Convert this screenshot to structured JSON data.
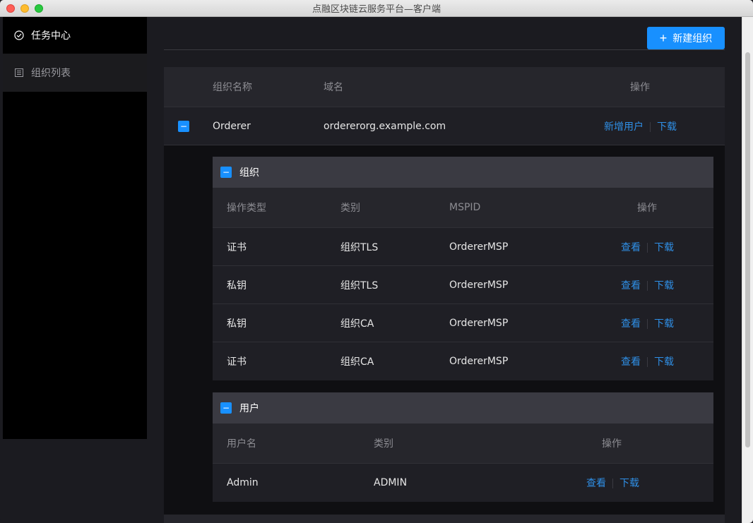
{
  "window": {
    "title": "点融区块链云服务平台—客户端"
  },
  "sidebar": {
    "items": [
      {
        "label": "任务中心",
        "icon": "check-circle-icon",
        "active": true
      },
      {
        "label": "组织列表",
        "icon": "list-icon",
        "active": false
      }
    ]
  },
  "toolbar": {
    "new_org_label": "新建组织"
  },
  "org_table": {
    "columns": [
      "组织名称",
      "域名",
      "操作"
    ],
    "rows": [
      {
        "name": "Orderer",
        "domain": "ordererorg.example.com",
        "actions": [
          "新增用户",
          "下载"
        ]
      }
    ]
  },
  "org_section": {
    "title": "组织",
    "columns": [
      "操作类型",
      "类别",
      "MSPID",
      "操作"
    ],
    "rows": [
      {
        "type": "证书",
        "category": "组织TLS",
        "mspid": "OrdererMSP",
        "actions": [
          "查看",
          "下载"
        ]
      },
      {
        "type": "私钥",
        "category": "组织TLS",
        "mspid": "OrdererMSP",
        "actions": [
          "查看",
          "下载"
        ]
      },
      {
        "type": "私钥",
        "category": "组织CA",
        "mspid": "OrdererMSP",
        "actions": [
          "查看",
          "下载"
        ]
      },
      {
        "type": "证书",
        "category": "组织CA",
        "mspid": "OrdererMSP",
        "actions": [
          "查看",
          "下载"
        ]
      }
    ]
  },
  "user_section": {
    "title": "用户",
    "columns": [
      "用户名",
      "类别",
      "操作"
    ],
    "rows": [
      {
        "username": "Admin",
        "category": "ADMIN",
        "actions": [
          "查看",
          "下载"
        ]
      }
    ]
  },
  "colors": {
    "accent": "#1890ff",
    "link": "#2f8fe6"
  }
}
